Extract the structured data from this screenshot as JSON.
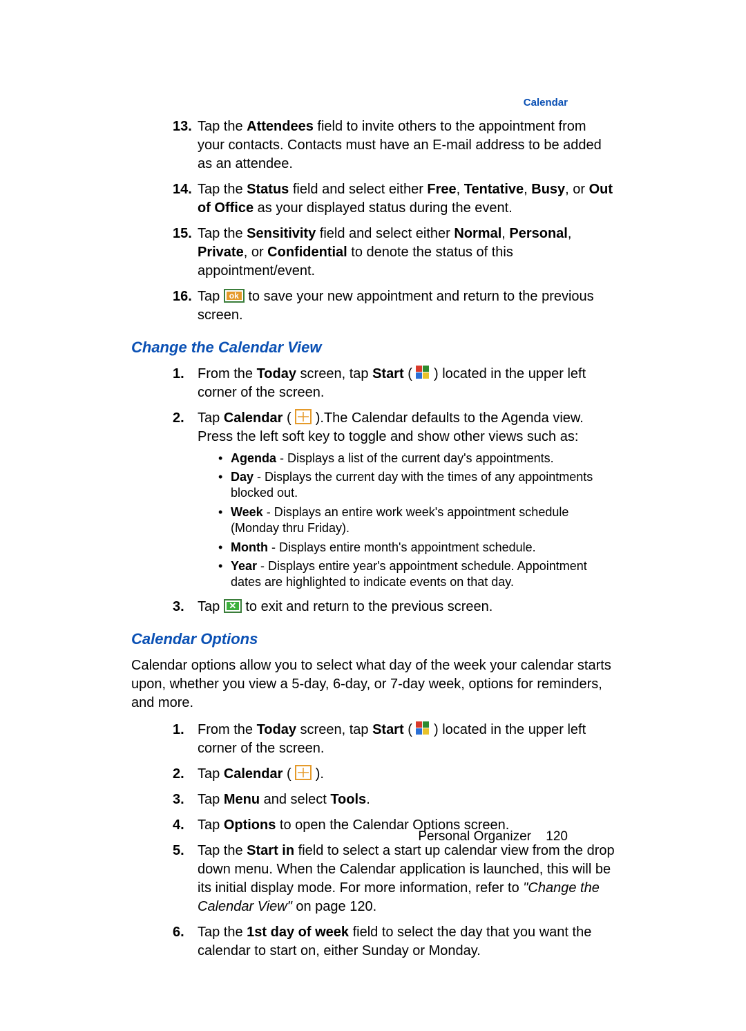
{
  "header": {
    "link": "Calendar"
  },
  "icons": {
    "ok_label": "ok",
    "x_label": "✕"
  },
  "sect1": {
    "items": [
      {
        "n": "13.",
        "t1": "Tap the ",
        "b1": "Attendees",
        "t2": " field to invite others to the appointment from your contacts. Contacts must have an E-mail address to be added as an attendee."
      },
      {
        "n": "14.",
        "t1": "Tap the ",
        "b1": "Status",
        "t2": " field and select either ",
        "b2": "Free",
        "t3": ", ",
        "b3": "Tentative",
        "t4": ", ",
        "b4": "Busy",
        "t5": ", or ",
        "b5": "Out of Office",
        "t6": " as your displayed status during the event."
      },
      {
        "n": "15.",
        "t1": "Tap the ",
        "b1": "Sensitivity",
        "t2": " field and select either ",
        "b2": "Normal",
        "t3": ", ",
        "b3": "Personal",
        "t4": ", ",
        "b4": "Private",
        "t5": ", or ",
        "b5": "Confidential",
        "t6": " to denote the status of this appointment/event."
      },
      {
        "n": "16.",
        "t1": "Tap ",
        "t2": " to save your new appointment and return to the previous screen."
      }
    ]
  },
  "h1": "Change the Calendar View",
  "sect2": {
    "items": [
      {
        "n": "1.",
        "t1": "From the ",
        "b1": "Today",
        "t2": " screen, tap ",
        "b2": "Start",
        "t3": " (",
        "t4": ") located in the upper left corner of the screen."
      },
      {
        "n": "2.",
        "t1": "Tap ",
        "b1": "Calendar",
        "t2": " ( ",
        "t3": " ).The Calendar defaults to the Agenda view. Press the left soft key to toggle and show other views such as:"
      },
      {
        "n": "3.",
        "t1": "Tap ",
        "t2": " to exit and return to the previous screen."
      }
    ],
    "views": [
      {
        "b": "Agenda",
        "t": " - Displays a list of the current day's appointments."
      },
      {
        "b": "Day",
        "t": " - Displays the current day with the times of any appointments blocked out."
      },
      {
        "b": "Week",
        "t": " - Displays an entire work week's appointment schedule (Monday thru Friday)."
      },
      {
        "b": "Month",
        "t": " - Displays entire month's appointment schedule."
      },
      {
        "b": "Year",
        "t": " - Displays entire year's appointment schedule. Appointment dates are highlighted to indicate events on that day."
      }
    ]
  },
  "h2": "Calendar Options",
  "intro": "Calendar options allow you to select what day of the week your calendar starts upon, whether you view a 5-day, 6-day, or 7-day week, options for reminders, and more.",
  "sect3": {
    "items": [
      {
        "n": "1.",
        "t1": "From the ",
        "b1": "Today",
        "t2": " screen, tap ",
        "b2": "Start",
        "t3": " (",
        "t4": ") located in the upper left corner of the screen."
      },
      {
        "n": "2.",
        "t1": "Tap ",
        "b1": "Calendar",
        "t2": " ( ",
        "t3": " )."
      },
      {
        "n": "3.",
        "t1": "Tap ",
        "b1": "Menu",
        "t2": " and select ",
        "b2": "Tools",
        "t3": "."
      },
      {
        "n": "4.",
        "t1": "Tap ",
        "b1": "Options",
        "t2": " to open the Calendar Options screen."
      },
      {
        "n": "5.",
        "t1": "Tap the ",
        "b1": "Start in",
        "t2": " field to select a start up calendar view from the drop down menu. When the Calendar application is launched, this will be its initial display mode. For more information, refer to ",
        "i1": "\"Change the Calendar View\"",
        "t3": " on page 120."
      },
      {
        "n": "6.",
        "t1": "Tap the ",
        "b1": "1st day of week",
        "t2": " field to select the day that you want the calendar to start on, either Sunday or Monday."
      }
    ]
  },
  "footer": {
    "section": "Personal Organizer",
    "page": "120"
  }
}
